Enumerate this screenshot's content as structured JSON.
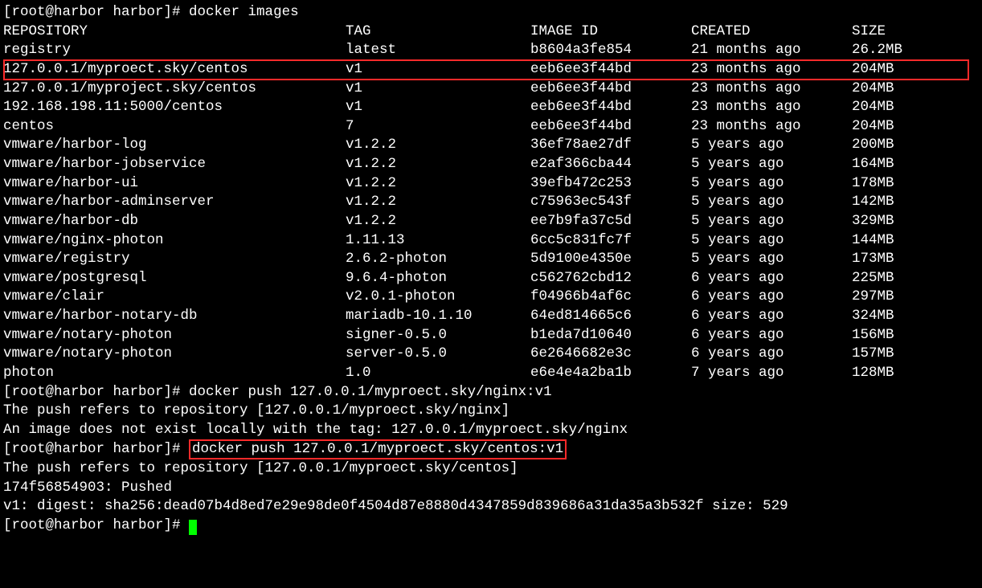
{
  "prompt": "[root@harbor harbor]# ",
  "cmd1": "docker images",
  "headers": {
    "repo": "REPOSITORY",
    "tag": "TAG",
    "id": "IMAGE ID",
    "created": "CREATED",
    "size": "SIZE"
  },
  "rows": [
    {
      "repo": "registry",
      "tag": "latest",
      "id": "b8604a3fe854",
      "created": "21 months ago",
      "size": "26.2MB",
      "hl": false
    },
    {
      "repo": "127.0.0.1/myproect.sky/centos",
      "tag": "v1",
      "id": "eeb6ee3f44bd",
      "created": "23 months ago",
      "size": "204MB",
      "hl": true
    },
    {
      "repo": "127.0.0.1/myproject.sky/centos",
      "tag": "v1",
      "id": "eeb6ee3f44bd",
      "created": "23 months ago",
      "size": "204MB",
      "hl": false
    },
    {
      "repo": "192.168.198.11:5000/centos",
      "tag": "v1",
      "id": "eeb6ee3f44bd",
      "created": "23 months ago",
      "size": "204MB",
      "hl": false
    },
    {
      "repo": "centos",
      "tag": "7",
      "id": "eeb6ee3f44bd",
      "created": "23 months ago",
      "size": "204MB",
      "hl": false
    },
    {
      "repo": "vmware/harbor-log",
      "tag": "v1.2.2",
      "id": "36ef78ae27df",
      "created": "5 years ago",
      "size": "200MB",
      "hl": false
    },
    {
      "repo": "vmware/harbor-jobservice",
      "tag": "v1.2.2",
      "id": "e2af366cba44",
      "created": "5 years ago",
      "size": "164MB",
      "hl": false
    },
    {
      "repo": "vmware/harbor-ui",
      "tag": "v1.2.2",
      "id": "39efb472c253",
      "created": "5 years ago",
      "size": "178MB",
      "hl": false
    },
    {
      "repo": "vmware/harbor-adminserver",
      "tag": "v1.2.2",
      "id": "c75963ec543f",
      "created": "5 years ago",
      "size": "142MB",
      "hl": false
    },
    {
      "repo": "vmware/harbor-db",
      "tag": "v1.2.2",
      "id": "ee7b9fa37c5d",
      "created": "5 years ago",
      "size": "329MB",
      "hl": false
    },
    {
      "repo": "vmware/nginx-photon",
      "tag": "1.11.13",
      "id": "6cc5c831fc7f",
      "created": "5 years ago",
      "size": "144MB",
      "hl": false
    },
    {
      "repo": "vmware/registry",
      "tag": "2.6.2-photon",
      "id": "5d9100e4350e",
      "created": "5 years ago",
      "size": "173MB",
      "hl": false
    },
    {
      "repo": "vmware/postgresql",
      "tag": "9.6.4-photon",
      "id": "c562762cbd12",
      "created": "6 years ago",
      "size": "225MB",
      "hl": false
    },
    {
      "repo": "vmware/clair",
      "tag": "v2.0.1-photon",
      "id": "f04966b4af6c",
      "created": "6 years ago",
      "size": "297MB",
      "hl": false
    },
    {
      "repo": "vmware/harbor-notary-db",
      "tag": "mariadb-10.1.10",
      "id": "64ed814665c6",
      "created": "6 years ago",
      "size": "324MB",
      "hl": false
    },
    {
      "repo": "vmware/notary-photon",
      "tag": "signer-0.5.0",
      "id": "b1eda7d10640",
      "created": "6 years ago",
      "size": "156MB",
      "hl": false
    },
    {
      "repo": "vmware/notary-photon",
      "tag": "server-0.5.0",
      "id": "6e2646682e3c",
      "created": "6 years ago",
      "size": "157MB",
      "hl": false
    },
    {
      "repo": "photon",
      "tag": "1.0",
      "id": "e6e4e4a2ba1b",
      "created": "7 years ago",
      "size": "128MB",
      "hl": false
    }
  ],
  "cmd2": "docker push 127.0.0.1/myproect.sky/nginx:v1",
  "out2a": "The push refers to repository [127.0.0.1/myproect.sky/nginx]",
  "out2b": "An image does not exist locally with the tag: 127.0.0.1/myproect.sky/nginx",
  "cmd3": "docker push 127.0.0.1/myproect.sky/centos:v1",
  "out3a": "The push refers to repository [127.0.0.1/myproect.sky/centos]",
  "out3b": "174f56854903: Pushed",
  "out3c": "v1: digest: sha256:dead07b4d8ed7e29e98de0f4504d87e8880d4347859d839686a31da35a3b532f size: 529"
}
